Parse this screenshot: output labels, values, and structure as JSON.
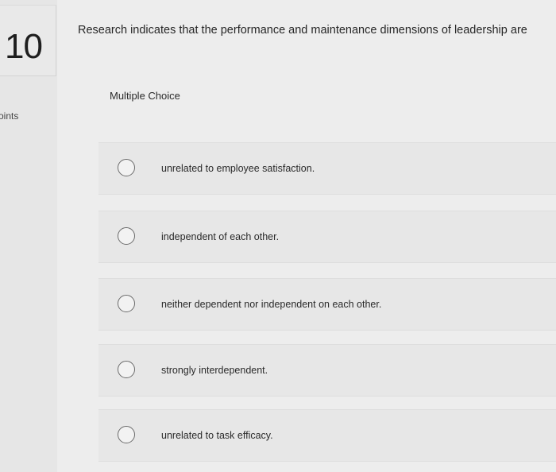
{
  "question": {
    "number": "10",
    "points_label": "oints",
    "text": "Research indicates that the performance and maintenance dimensions of leadership are"
  },
  "answer_type": "Multiple Choice",
  "options": [
    {
      "label": "unrelated to employee satisfaction."
    },
    {
      "label": "independent of each other."
    },
    {
      "label": "neither dependent nor independent on each other."
    },
    {
      "label": "strongly interdependent."
    },
    {
      "label": "unrelated to task efficacy."
    }
  ]
}
